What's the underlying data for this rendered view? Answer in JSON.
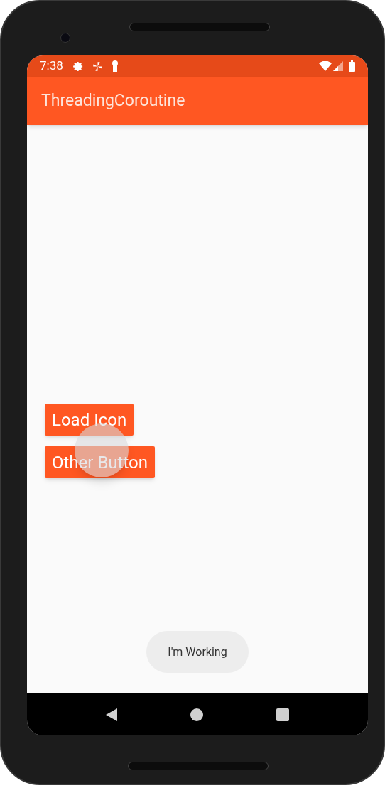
{
  "status_bar": {
    "time": "7:38"
  },
  "app_bar": {
    "title": "ThreadingCoroutine"
  },
  "buttons": [
    {
      "label": "Load Icon"
    },
    {
      "label": "Other Button"
    }
  ],
  "toast": {
    "text": "I'm Working"
  }
}
